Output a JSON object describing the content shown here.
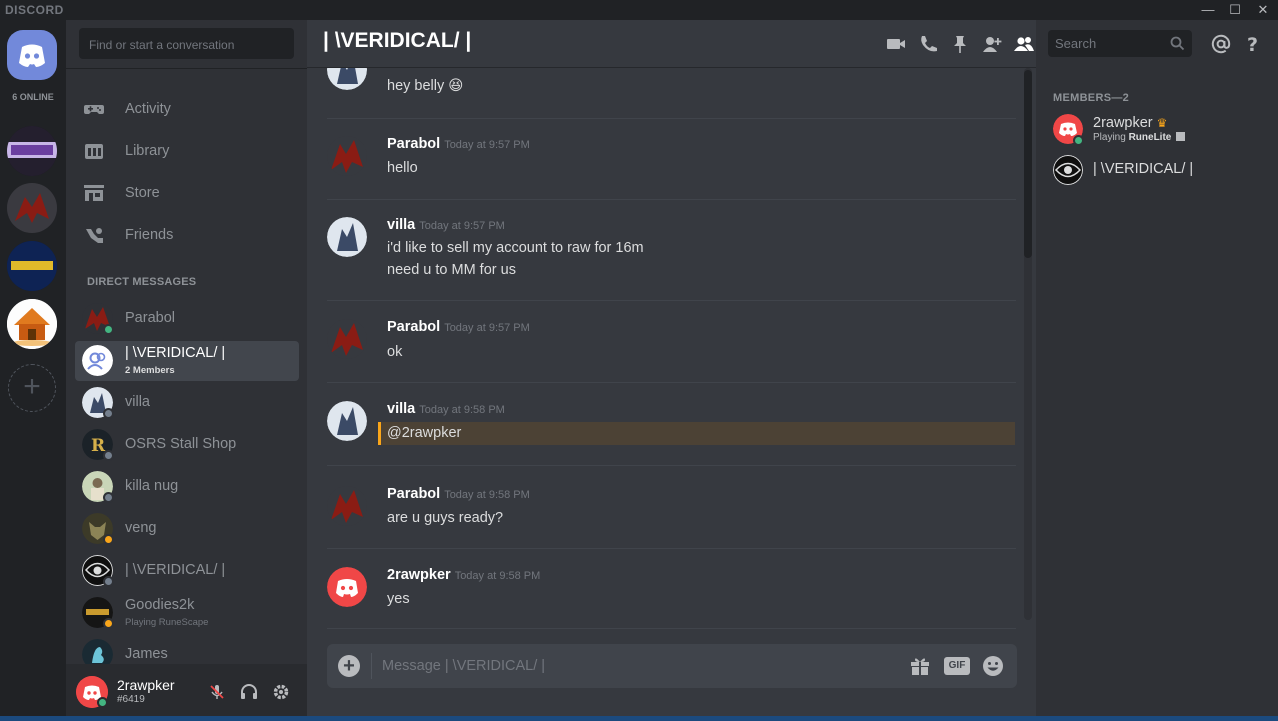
{
  "app": {
    "brand": "DISCORD"
  },
  "window_controls": {
    "minimize": "—",
    "maximize": "☐",
    "close": "✕"
  },
  "guilds": {
    "online_count": "6 ONLINE",
    "add_label": "+"
  },
  "sidebar": {
    "search_placeholder": "Find or start a conversation",
    "nav": [
      {
        "label": "Activity",
        "icon": "gamepad-icon"
      },
      {
        "label": "Library",
        "icon": "library-icon"
      },
      {
        "label": "Store",
        "icon": "store-icon"
      },
      {
        "label": "Friends",
        "icon": "friends-icon"
      }
    ],
    "dm_header": "DIRECT MESSAGES",
    "dms": [
      {
        "name": "Parabol",
        "sub": "",
        "status": "online"
      },
      {
        "name": "| \\VERIDICAL/ |",
        "sub": "2 Members",
        "status": "none"
      },
      {
        "name": "villa",
        "sub": "",
        "status": "offline"
      },
      {
        "name": "OSRS Stall Shop",
        "sub": "",
        "status": "offline"
      },
      {
        "name": "killa nug",
        "sub": "",
        "status": "offline"
      },
      {
        "name": "veng",
        "sub": "",
        "status": "idle"
      },
      {
        "name": "| \\VERIDICAL/ |",
        "sub": "",
        "status": "offline"
      },
      {
        "name": "Goodies2k",
        "sub": "Playing RuneScape",
        "status": "idle"
      },
      {
        "name": "James",
        "sub": "",
        "status": "none"
      }
    ],
    "user": {
      "name": "2rawpker",
      "tag": "#6419"
    }
  },
  "chat": {
    "title": "| \\VERIDICAL/ |",
    "search_placeholder": "Search",
    "messages": [
      {
        "author": "",
        "time": "",
        "lines": [
          "hey belly 😆"
        ]
      },
      {
        "author": "Parabol",
        "time": "Today at 9:57 PM",
        "lines": [
          "hello"
        ]
      },
      {
        "author": "villa",
        "time": "Today at 9:57 PM",
        "lines": [
          "i'd like to sell my account to raw for 16m",
          "need u to MM for us"
        ]
      },
      {
        "author": "Parabol",
        "time": "Today at 9:57 PM",
        "lines": [
          "ok"
        ]
      },
      {
        "author": "villa",
        "time": "Today at 9:58 PM",
        "lines": [
          "@2rawpker"
        ]
      },
      {
        "author": "Parabol",
        "time": "Today at 9:58 PM",
        "lines": [
          "are u guys ready?"
        ]
      },
      {
        "author": "2rawpker",
        "time": "Today at 9:58 PM",
        "lines": [
          "yes"
        ]
      }
    ],
    "composer_placeholder": "Message | \\VERIDICAL/ |",
    "gif_label": "GIF"
  },
  "members": {
    "header": "MEMBERS—2",
    "list": [
      {
        "name": "2rawpker",
        "activity_prefix": "Playing ",
        "activity_name": "RuneLite",
        "owner_icon": "♛"
      },
      {
        "name": "| \\VERIDICAL/ |"
      }
    ]
  },
  "colors": {
    "blurple": "#7289da",
    "online": "#43b581",
    "idle": "#faa61a",
    "offline": "#747f8d",
    "red_avatar": "#f04747"
  }
}
